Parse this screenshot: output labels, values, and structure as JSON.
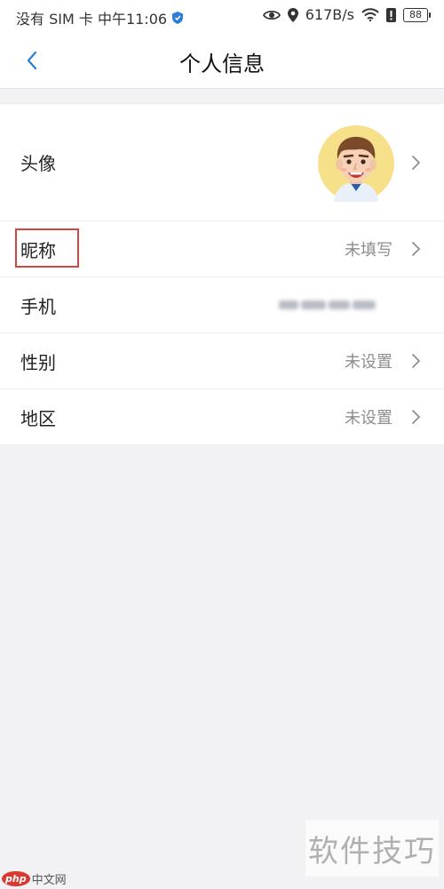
{
  "status_bar": {
    "carrier_time": "没有 SIM 卡 中午11:06",
    "speed": "617B/s",
    "battery": "88"
  },
  "header": {
    "title": "个人信息"
  },
  "rows": [
    {
      "label": "头像",
      "value": ""
    },
    {
      "label": "昵称",
      "value": "未填写"
    },
    {
      "label": "手机",
      "value": ""
    },
    {
      "label": "性别",
      "value": "未设置"
    },
    {
      "label": "地区",
      "value": "未设置"
    }
  ],
  "watermark": {
    "right_text": "软件技巧",
    "left_logo": "php",
    "left_text": "中文网"
  },
  "colors": {
    "accent": "#2d7cd6",
    "highlight": "#d64541"
  }
}
